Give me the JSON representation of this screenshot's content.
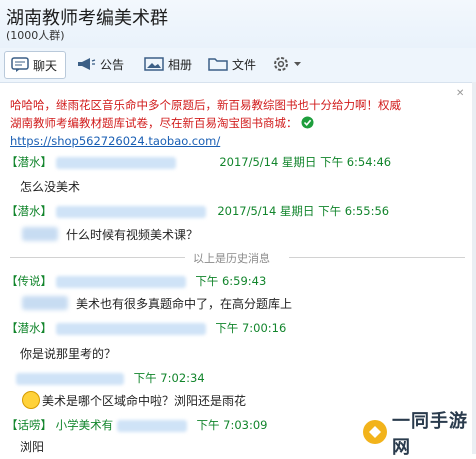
{
  "window": {
    "title": "湖南教师考编美术群",
    "subtitle": "(1000人群)"
  },
  "toolbar": {
    "chat_label": "聊天",
    "notice_label": "公告",
    "album_label": "相册",
    "file_label": "文件"
  },
  "notice": {
    "line1": "哈哈哈，继雨花区音乐命中多个原题后，新百易教综图书也十分给力啊！权威",
    "line2": "湖南教师考编教材题库试卷，尽在新百易淘宝图书商城：",
    "link": "https://shop562726024.taobao.com/"
  },
  "messages": [
    {
      "tag": "【潜水】",
      "time": "2017/5/14 星期日 下午 6:54:46",
      "text": "怎么没美术"
    },
    {
      "tag": "【潜水】",
      "time": "2017/5/14 星期日 下午 6:55:56",
      "text": "什么时候有视频美术课？"
    },
    {
      "tag": "【传说】",
      "time": "下午 6:59:43",
      "text": "美术也有很多真题命中了，在高分题库上"
    },
    {
      "tag": "【潜水】",
      "time": "下午 7:00:16",
      "text": "你是说那里考的？"
    },
    {
      "tag": "",
      "time": "下午 7:02:34",
      "text": "美术是哪个区域命中啦？浏阳还是雨花"
    },
    {
      "tag": "【话唠】",
      "name": "小学美术有",
      "time": "下午 7:03:09",
      "text": "浏阳"
    }
  ],
  "divider": {
    "label": "以上是历史消息"
  },
  "watermark": {
    "text": "一同手游网"
  }
}
